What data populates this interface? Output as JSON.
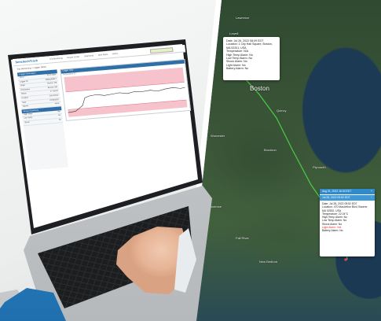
{
  "app": {
    "logo": "SensitechTrack",
    "nav": [
      "Trip Monitoring",
      "Report Center",
      "Shipments",
      "Alert Rules",
      "Admin"
    ],
    "breadcrumb": "Trip Monitoring > Logger Detail",
    "chart_title": "Logger Data",
    "chart_subtitle": "Temperature (F)",
    "sidebar_header": "Logger Information",
    "sidebar_rows": [
      {
        "label": "Trip #",
        "value": "3P17-0094"
      },
      {
        "label": "Logger ID",
        "value": "4N8AQ65917"
      },
      {
        "label": "Origin",
        "value": "Boston, MA"
      },
      {
        "label": "Destination",
        "value": "Bourne, MA"
      },
      {
        "label": "Status",
        "value": "In Transit"
      },
      {
        "label": "Product",
        "value": "Cold Chain"
      },
      {
        "label": "Start",
        "value": "07/26/2022"
      },
      {
        "label": "Alarms",
        "value": "None"
      }
    ],
    "sidebar_header2": "Sensor Summary",
    "sidebar_rows2": [
      {
        "label": "High Temp",
        "value": "No"
      },
      {
        "label": "Low Temp",
        "value": "No"
      },
      {
        "label": "Shock",
        "value": "No"
      }
    ]
  },
  "map": {
    "city_label": "Boston",
    "place_labels": [
      "Lawrence",
      "Lowell",
      "Worcester",
      "Quincy",
      "Brockton",
      "Plymouth",
      "Providence",
      "Fall River",
      "New Bedford"
    ],
    "route_color": "#4fe04a",
    "popup_top": {
      "date": "Date: Jul 26, 2022 08:09 EDT",
      "location": "Location: 1 City Hall Square, Boston, MA 02201, USA",
      "temperature": "Temperature: N/A",
      "high_temp_alarm": "High Temp Alarm: No",
      "low_temp_alarm": "Low Temp Alarm: No",
      "shock_alarm": "Shock Alarm: No",
      "light_alarm": "Light Alarm: No",
      "battery_alarm": "Battery Alarm: No"
    },
    "popup_bottom": {
      "header1": "Aug 01, 2022 16:30 EDT",
      "header2": "Jul 28, 2022 09:52 EDT",
      "date": "Date: Jul 28, 2022 09:52 EDT",
      "location": "Location: 470 MacArthur Blvd, Bourne, MA 02532, USA",
      "temperature": "Temperature: 22.04°C",
      "high_temp_alarm": "High Temp Alarm: No",
      "low_temp_alarm": "Low Temp Alarm: No",
      "shock_alarm": "Shock Alarm: No",
      "light_alarm": "Light Alarm: Yes",
      "battery_alarm": "Battery Alarm: No"
    }
  }
}
